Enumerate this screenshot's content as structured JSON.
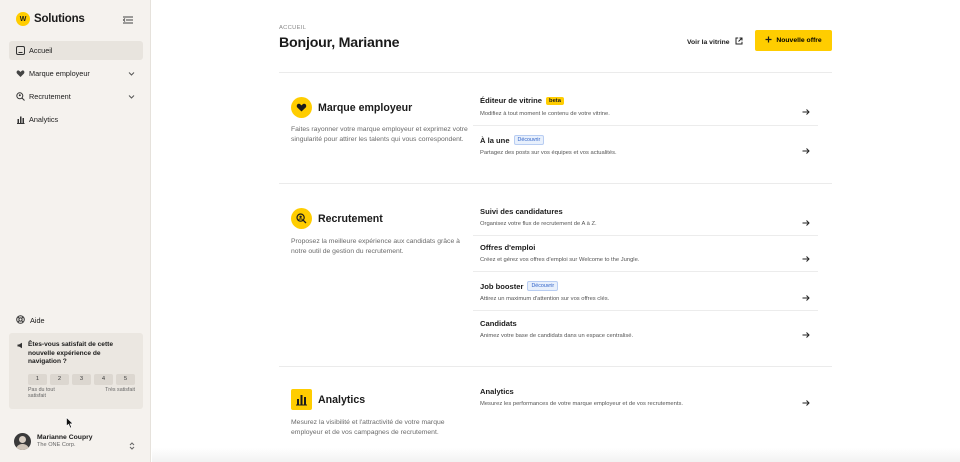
{
  "brand": {
    "name": "Solutions",
    "logo_text": "W"
  },
  "sidebar": {
    "items": [
      {
        "label": "Accueil",
        "icon": "home-icon"
      },
      {
        "label": "Marque employeur",
        "icon": "heart-icon"
      },
      {
        "label": "Recrutement",
        "icon": "search-person-icon"
      },
      {
        "label": "Analytics",
        "icon": "bar-chart-icon"
      }
    ],
    "help_label": "Aide",
    "survey": {
      "question": "Êtes-vous satisfait de cette nouvelle expérience de navigation ?",
      "scale": [
        "1",
        "2",
        "3",
        "4",
        "5"
      ],
      "low_label": "Pas du tout satisfait",
      "high_label": "Très satisfait"
    },
    "user": {
      "name": "Marianne Coupry",
      "org": "The ONE Corp."
    }
  },
  "header": {
    "breadcrumb": "ACCUEIL",
    "title": "Bonjour, Marianne",
    "vitrine_label": "Voir la vitrine",
    "new_offer_label": "Nouvelle offre"
  },
  "sections": [
    {
      "title": "Marque employeur",
      "icon": "heart-icon",
      "description": "Faites rayonner votre marque employeur et exprimez votre singularité pour attirer les talents qui vous correspondent.",
      "rows": [
        {
          "title": "Éditeur de vitrine",
          "badge": "beta",
          "subtitle": "Modifiez à tout moment le contenu de votre vitrine."
        },
        {
          "title": "À la une",
          "badge": "Découvrir",
          "subtitle": "Partagez des posts sur vos équipes et vos actualités."
        }
      ]
    },
    {
      "title": "Recrutement",
      "icon": "search-person-icon",
      "description": "Proposez la meilleure expérience aux candidats grâce à notre outil de gestion du recrutement.",
      "rows": [
        {
          "title": "Suivi des candidatures",
          "subtitle": "Organisez votre flux de recrutement de A à Z."
        },
        {
          "title": "Offres d'emploi",
          "subtitle": "Créez et gérez vos offres d'emploi sur Welcome to the Jungle."
        },
        {
          "title": "Job booster",
          "badge": "Découvrir",
          "subtitle": "Attirez un maximum d'attention sur vos offres clés."
        },
        {
          "title": "Candidats",
          "subtitle": "Animez votre base de candidats dans un espace centralisé."
        }
      ]
    },
    {
      "title": "Analytics",
      "icon": "bar-chart-icon",
      "description": "Mesurez la visibilité et l'attractivité de votre marque employeur et de vos campagnes de recrutement.",
      "rows": [
        {
          "title": "Analytics",
          "subtitle": "Mesurez les performances de votre marque employeur et de vos recrutements."
        }
      ]
    }
  ],
  "colors": {
    "accent": "#ffcd00",
    "sidebar_bg": "#f5f2ee",
    "badge_blue": "#2b5fc7"
  }
}
